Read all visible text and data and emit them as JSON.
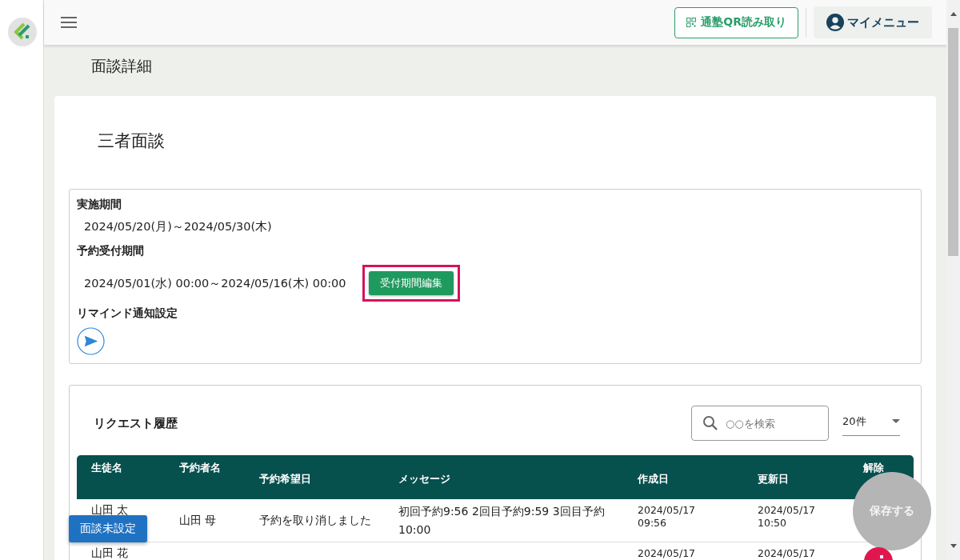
{
  "header": {
    "qr_button": "通塾QR読み取り",
    "menu_button": "マイメニュー"
  },
  "page_title": "面談詳細",
  "card": {
    "title": "三者面談",
    "info": {
      "period_label": "実施期間",
      "period": "2024/05/20(月)～2024/05/30(木)",
      "accept_label": "予約受付期間",
      "accept": "2024/05/01(水) 00:00～2024/05/16(木) 00:00",
      "edit_button": "受付期間編集",
      "edit_highlighted": true,
      "remind_label": "リマインド通知設定"
    },
    "requests": {
      "title": "リクエスト履歴",
      "search": {
        "placeholder": "○○を検索"
      },
      "per_page": "20件",
      "table": {
        "columns": [
          "生徒名",
          "予約者名",
          "予約希望日",
          "メッセージ",
          "作成日",
          "更新日",
          "解除"
        ],
        "rows": [
          {
            "student": "山田 太",
            "reserver": "山田 母",
            "desired": "予約を取り消しました",
            "message": "初回予約9:56 2回目予約9:59 3回目予約10:00",
            "created": "2024/05/17 09:56",
            "updated": "2024/05/17 10:50"
          },
          {
            "student": "山田 花",
            "created": "2024/05/17",
            "updated": "2024/05/17"
          }
        ]
      }
    }
  },
  "floating": {
    "unset_button": "面談未設定",
    "save_button": "保存する",
    "save_disabled": true
  }
}
